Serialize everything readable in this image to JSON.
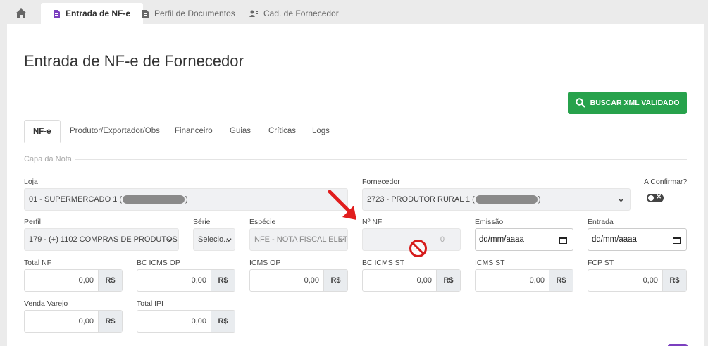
{
  "top_tabs": [
    {
      "label": "Entrada de NF-e",
      "icon": "file-icon"
    },
    {
      "label": "Perfil de Documentos",
      "icon": "file-icon"
    },
    {
      "label": "Cad. de Fornecedor",
      "icon": "users-icon"
    }
  ],
  "page_title": "Entrada de NF-e de Fornecedor",
  "buscar_button": "BUSCAR XML VALIDADO",
  "sub_tabs": [
    "NF-e",
    "Produtor/Exportador/Obs",
    "Financeiro",
    "Guias",
    "Críticas",
    "Logs"
  ],
  "section_legend": "Capa da Nota",
  "fields": {
    "loja": {
      "label": "Loja",
      "value_prefix": "01 - SUPERMERCADO 1 (",
      "value_suffix": ")"
    },
    "fornecedor": {
      "label": "Fornecedor",
      "value_prefix": "2723 - PRODUTOR RURAL 1 (",
      "value_suffix": ")"
    },
    "a_confirmar": {
      "label": "A Confirmar?",
      "checked": false
    },
    "perfil": {
      "label": "Perfil",
      "value": "179 - (+) 1102  COMPRAS DE PRODUTOS"
    },
    "serie": {
      "label": "Série",
      "value": "Selecio..."
    },
    "especie": {
      "label": "Espécie",
      "value": "NFE - NOTA FISCAL ELETRÔNICA"
    },
    "num_nf": {
      "label": "Nº NF",
      "value": "0"
    },
    "emissao": {
      "label": "Emissão",
      "value": "dd/mm/aaaa"
    },
    "entrada": {
      "label": "Entrada",
      "value": "dd/mm/aaaa"
    },
    "total_nf": {
      "label": "Total NF",
      "value": "0,00"
    },
    "bc_icms_op": {
      "label": "BC ICMS OP",
      "value": "0,00"
    },
    "icms_op": {
      "label": "ICMS OP",
      "value": "0,00"
    },
    "bc_icms_st": {
      "label": "BC ICMS ST",
      "value": "0,00"
    },
    "icms_st": {
      "label": "ICMS ST",
      "value": "0,00"
    },
    "fcp_st": {
      "label": "FCP ST",
      "value": "0,00"
    },
    "venda_varejo": {
      "label": "Venda Varejo",
      "value": "0,00"
    },
    "total_ipi": {
      "label": "Total IPI",
      "value": "0,00"
    }
  },
  "currency": "R$",
  "colors": {
    "accent_purple": "#7b3fbf",
    "button_green": "#27a24c",
    "arrow_red": "#e11d1d"
  }
}
